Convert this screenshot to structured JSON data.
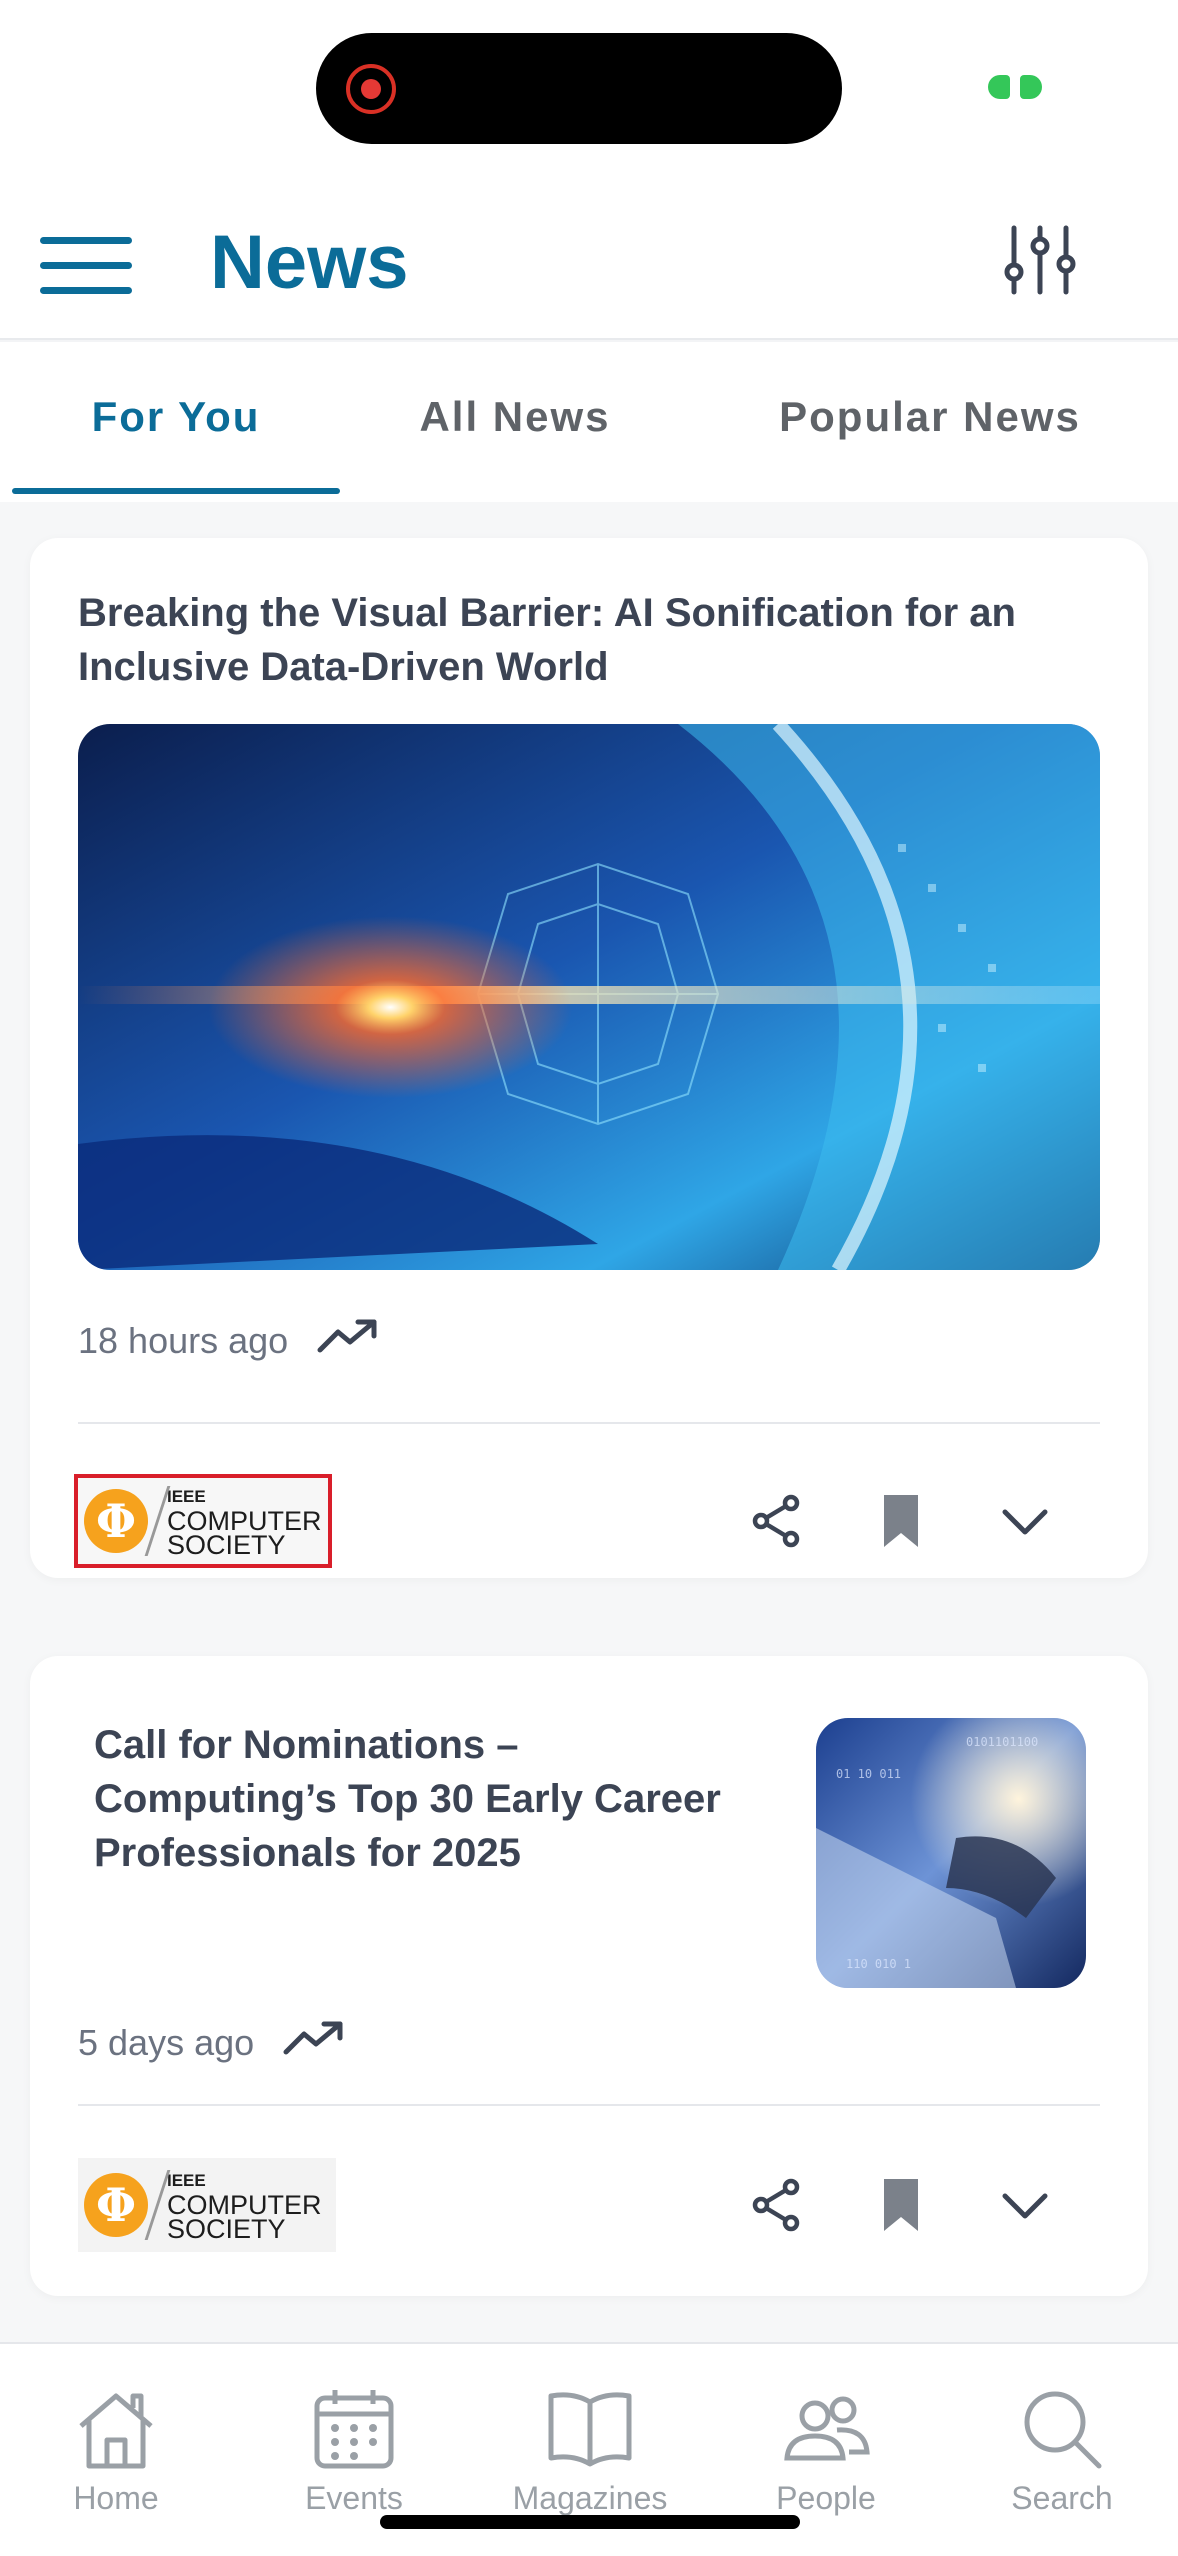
{
  "header": {
    "title": "News"
  },
  "tabs": [
    {
      "label": "For You",
      "active": true
    },
    {
      "label": "All News",
      "active": false
    },
    {
      "label": "Popular News",
      "active": false
    }
  ],
  "articles": [
    {
      "title": "Breaking the Visual Barrier: AI Sonification for an Inclusive Data-Driven World",
      "time": "18 hours ago",
      "trending": true,
      "source": {
        "line1": "IEEE",
        "line2": "COMPUTER",
        "line3": "SOCIETY",
        "symbol": "Φ"
      }
    },
    {
      "title": "Call for Nominations – Computing’s Top 30 Early Career Professionals for 2025",
      "time": "5 days ago",
      "trending": true,
      "source": {
        "line1": "IEEE",
        "line2": "COMPUTER",
        "line3": "SOCIETY",
        "symbol": "Φ"
      }
    }
  ],
  "nav": [
    {
      "label": "Home",
      "icon": "home-icon"
    },
    {
      "label": "Events",
      "icon": "calendar-icon"
    },
    {
      "label": "Magazines",
      "icon": "book-icon"
    },
    {
      "label": "People",
      "icon": "people-icon"
    },
    {
      "label": "Search",
      "icon": "search-icon"
    }
  ],
  "colors": {
    "brand": "#0b6c98",
    "logo_orange": "#f6a21d",
    "highlight": "#d91e2a"
  }
}
